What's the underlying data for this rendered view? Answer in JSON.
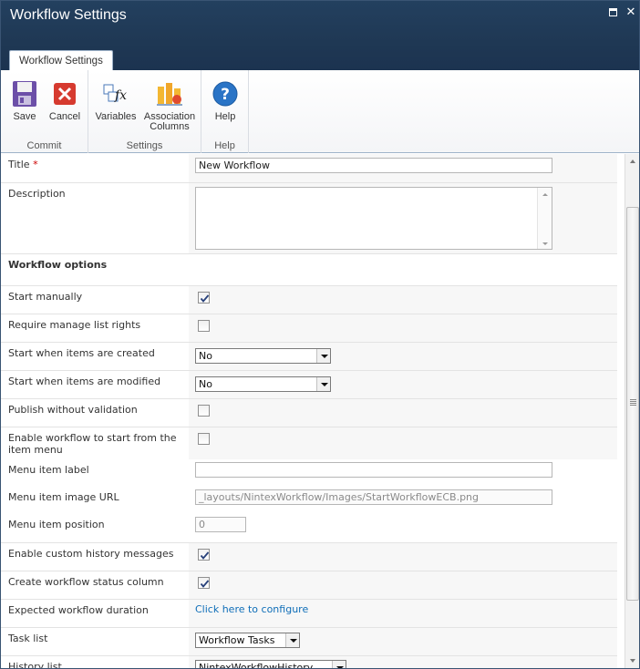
{
  "window": {
    "title": "Workflow Settings"
  },
  "ribbon": {
    "tab": "Workflow Settings",
    "groups": {
      "commit": {
        "label": "Commit",
        "save": "Save",
        "cancel": "Cancel"
      },
      "settings": {
        "label": "Settings",
        "variables": "Variables",
        "association_line1": "Association",
        "association_line2": "Columns"
      },
      "help": {
        "label": "Help",
        "help": "Help"
      }
    }
  },
  "form": {
    "title": {
      "label": "Title",
      "required_mark": "*",
      "value": "New Workflow"
    },
    "description": {
      "label": "Description",
      "value": ""
    },
    "section_workflow_options": "Workflow options",
    "start_manually": {
      "label": "Start manually",
      "checked": true
    },
    "require_manage_list_rights": {
      "label": "Require manage list rights",
      "checked": false
    },
    "start_when_created": {
      "label": "Start when items are created",
      "value": "No"
    },
    "start_when_modified": {
      "label": "Start when items are modified",
      "value": "No"
    },
    "publish_without_validation": {
      "label": "Publish without validation",
      "checked": false
    },
    "enable_start_from_menu": {
      "label": "Enable workflow to start from the item menu",
      "checked": false
    },
    "menu_item_label": {
      "label": "Menu item label",
      "value": ""
    },
    "menu_item_image_url": {
      "label": "Menu item image URL",
      "value": "_layouts/NintexWorkflow/Images/StartWorkflowECB.png"
    },
    "menu_item_position": {
      "label": "Menu item position",
      "value": "0"
    },
    "enable_custom_history": {
      "label": "Enable custom history messages",
      "checked": true
    },
    "create_status_column": {
      "label": "Create workflow status column",
      "checked": true
    },
    "expected_duration": {
      "label": "Expected workflow duration",
      "link": "Click here to configure"
    },
    "task_list": {
      "label": "Task list",
      "value": "Workflow Tasks"
    },
    "history_list": {
      "label": "History list",
      "value": "NintexWorkflowHistory"
    }
  },
  "colors": {
    "titlebar": "#1f3854",
    "link": "#0f6eb8",
    "required": "#cc0000"
  }
}
